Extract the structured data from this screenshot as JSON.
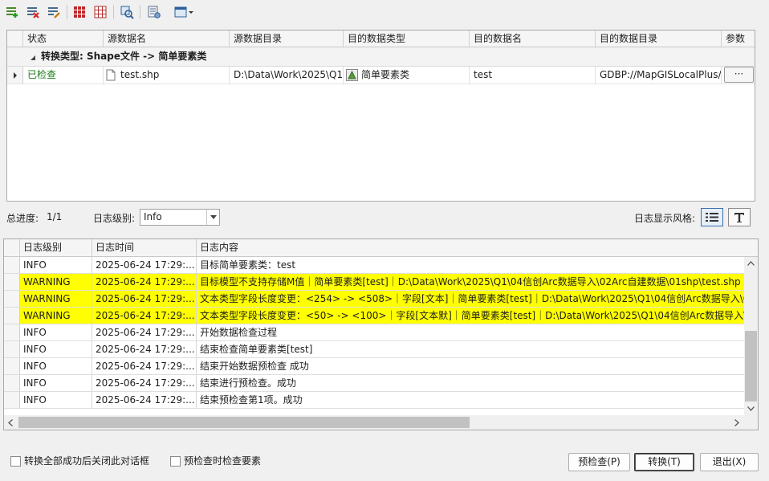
{
  "toolbar": {
    "buttons": [
      {
        "icon": "add-rows-icon"
      },
      {
        "icon": "delete-rows-icon"
      },
      {
        "icon": "edit-rows-icon"
      },
      {
        "icon": "grid-select-all-icon"
      },
      {
        "icon": "grid-clear-icon"
      },
      {
        "icon": "preview-icon"
      },
      {
        "icon": "settings-icon"
      },
      {
        "icon": "view-dropdown-icon"
      }
    ]
  },
  "task_grid": {
    "columns": [
      "状态",
      "源数据名",
      "源数据目录",
      "目的数据类型",
      "目的数据名",
      "目的数据目录",
      "参数"
    ],
    "group_label": "转换类型: Shape文件 -> 简单要素类",
    "rows": [
      {
        "status": "已检查",
        "source_name": "test.shp",
        "source_dir": "D:\\Data\\Work\\2025\\Q1\\0",
        "target_type": "简单要素类",
        "target_name": "test",
        "target_dir": "GDBP://MapGISLocalPlus/...",
        "params": "···"
      }
    ]
  },
  "progress": {
    "label": "总进度:",
    "value": "1/1",
    "log_level_label": "日志级别:",
    "log_level_value": "Info",
    "style_label": "日志显示风格:"
  },
  "log_grid": {
    "columns": [
      "日志级别",
      "日志时间",
      "日志内容"
    ],
    "rows": [
      {
        "level": "INFO",
        "time": "2025-06-24 17:29:...",
        "content": "目标简单要素类：test",
        "warn": false
      },
      {
        "level": "WARNING",
        "time": "2025-06-24 17:29:...",
        "content": "目标模型不支持存储M值｜简单要素类[test]｜D:\\Data\\Work\\2025\\Q1\\04信创Arc数据导入\\02Arc自建数据\\01shp\\test.shp",
        "warn": true
      },
      {
        "level": "WARNING",
        "time": "2025-06-24 17:29:...",
        "content": "文本类型字段长度变更：<254> -> <508>｜字段[文本]｜简单要素类[test]｜D:\\Data\\Work\\2025\\Q1\\04信创Arc数据导入\\02",
        "warn": true
      },
      {
        "level": "WARNING",
        "time": "2025-06-24 17:29:...",
        "content": "文本类型字段长度变更：<50> -> <100>｜字段[文本默]｜简单要素类[test]｜D:\\Data\\Work\\2025\\Q1\\04信创Arc数据导入\\0",
        "warn": true
      },
      {
        "level": "INFO",
        "time": "2025-06-24 17:29:...",
        "content": "开始数据检查过程",
        "warn": false
      },
      {
        "level": "INFO",
        "time": "2025-06-24 17:29:...",
        "content": "结束检查简单要素类[test]",
        "warn": false
      },
      {
        "level": "INFO",
        "time": "2025-06-24 17:29:...",
        "content": "结束开始数据预检查 成功",
        "warn": false
      },
      {
        "level": "INFO",
        "time": "2025-06-24 17:29:...",
        "content": "结束进行预检查。成功",
        "warn": false
      },
      {
        "level": "INFO",
        "time": "2025-06-24 17:29:...",
        "content": "结束预检查第1项。成功",
        "warn": false
      }
    ]
  },
  "options": {
    "close_after_success": "转换全部成功后关闭此对话框",
    "check_features": "预检查时检查要素"
  },
  "buttons": {
    "precheck": "预检查(P)",
    "convert": "转换(T)",
    "exit": "退出(X)"
  },
  "colors": {
    "warning_row": "#ffff00",
    "checked_status": "#1a7a1a"
  }
}
